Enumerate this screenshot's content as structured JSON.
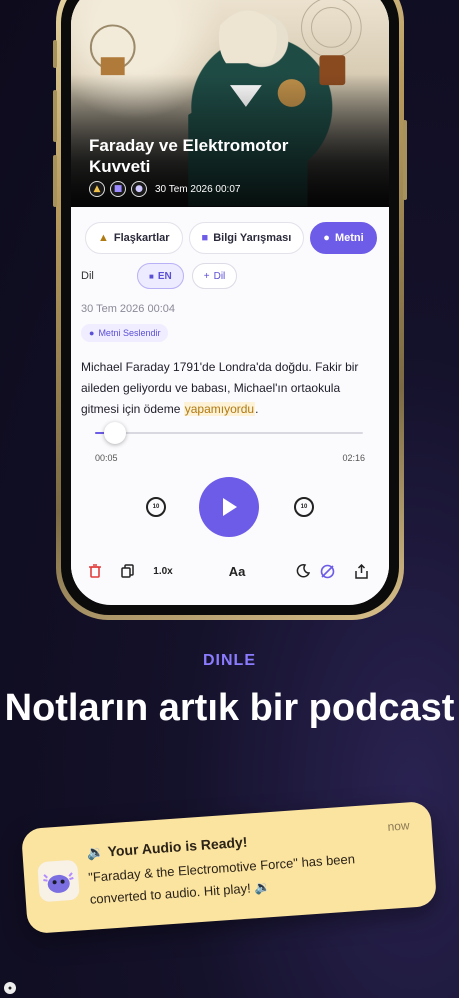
{
  "lesson": {
    "title": "Faraday ve Elektromotor Kuvveti",
    "date": "30 Tem 2026 00:07"
  },
  "tabs": [
    {
      "label": "Flaşkartlar",
      "icon": "cards-icon"
    },
    {
      "label": "Bilgi Yarışması",
      "icon": "quiz-icon"
    },
    {
      "label": "Metni",
      "icon": "voice-icon"
    }
  ],
  "language": {
    "label": "Dil",
    "current": "EN",
    "add": "Dil"
  },
  "document": {
    "date": "30 Tem 2026 00:04",
    "read_badge": "Metni Seslendir",
    "text_before": "Michael Faraday 1791'de Londra'da doğdu. Fakir bir aileden geliyordu ve babası, Michael'ın ortaokula gitmesi için ödeme ",
    "text_highlight": "yapamıyordu",
    "text_after": "."
  },
  "player": {
    "elapsed": "00:05",
    "total": "02:16",
    "progress": 0.037,
    "skip_back": "10",
    "skip_forward": "10",
    "speed": "1.0x",
    "font_label": "Aa"
  },
  "marketing": {
    "subheading": "DINLE",
    "headline": "Notların artık bir podcast"
  },
  "notification": {
    "title": "🔉 Your Audio is Ready!",
    "body": "\"Faraday & the Electromotive Force\" has been converted to audio. Hit play! 🔉",
    "time": "now"
  },
  "colors": {
    "accent": "#6c5ce7",
    "highlight": "#b07a12",
    "notification_bg": "#fbe3a0"
  }
}
